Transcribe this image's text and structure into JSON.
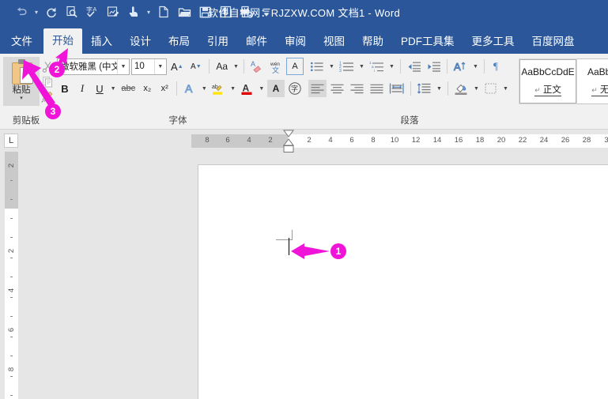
{
  "titlebar": {
    "title": "软件自学网：RJZXW.COM 文档1  -  Word",
    "qat": [
      {
        "name": "undo-icon",
        "glyph": "↶"
      },
      {
        "name": "redo-icon",
        "glyph": "↺"
      },
      {
        "name": "print-preview-icon",
        "glyph": "🗎"
      },
      {
        "name": "spelling-check-icon",
        "glyph": "字"
      },
      {
        "name": "edit-chart-icon",
        "glyph": "✎"
      },
      {
        "name": "touch-mode-icon",
        "glyph": "☝"
      },
      {
        "name": "new-document-icon",
        "glyph": "🗋"
      },
      {
        "name": "open-folder-icon",
        "glyph": "🗀"
      },
      {
        "name": "save-icon",
        "glyph": "🖫"
      },
      {
        "name": "attachment-icon",
        "glyph": "🖇"
      },
      {
        "name": "print-icon",
        "glyph": "🖶"
      },
      {
        "name": "customize-qat-icon",
        "glyph": "▾"
      }
    ]
  },
  "tabs": [
    {
      "label": "文件",
      "active": false
    },
    {
      "label": "开始",
      "active": true
    },
    {
      "label": "插入",
      "active": false
    },
    {
      "label": "设计",
      "active": false
    },
    {
      "label": "布局",
      "active": false
    },
    {
      "label": "引用",
      "active": false
    },
    {
      "label": "邮件",
      "active": false
    },
    {
      "label": "审阅",
      "active": false
    },
    {
      "label": "视图",
      "active": false
    },
    {
      "label": "帮助",
      "active": false
    },
    {
      "label": "PDF工具集",
      "active": false
    },
    {
      "label": "更多工具",
      "active": false
    },
    {
      "label": "百度网盘",
      "active": false
    }
  ],
  "ribbon": {
    "clipboard": {
      "group_label": "剪贴板",
      "paste_label": "粘贴",
      "paste_caret": "▾",
      "cut_icon": "✂",
      "copy_icon": "⧉",
      "format_painter_icon": "🖌"
    },
    "font": {
      "group_label": "字体",
      "font_name": "微软雅黑 (中文",
      "font_size": "10",
      "grow_font": "A",
      "shrink_font": "A",
      "change_case": "Aa",
      "clear_format": "✐",
      "phonetic": "wén",
      "char_border": "A",
      "bold": "B",
      "italic": "I",
      "underline": "U",
      "strikethrough": "abc",
      "subscript": "x₂",
      "superscript": "x²",
      "text_effects": "A",
      "highlight": "ab",
      "font_color": "A",
      "char_shading": "A",
      "enclose_chars": "字"
    },
    "paragraph": {
      "group_label": "段落",
      "bullets": "▪≡",
      "numbering": "1≡",
      "multilevel": "⁌≡",
      "decrease_indent": "◄≡",
      "increase_indent": "►≡",
      "sort": "A↓",
      "show_marks": "¶",
      "align_left": "≡",
      "align_center": "≡",
      "align_right": "≡",
      "justify": "≡",
      "distribute": "≡",
      "line_spacing": "↕≡",
      "shading": "◪",
      "borders": "⊞"
    },
    "styles": {
      "items": [
        {
          "preview": "AaBbCcDdE",
          "pilcrow": "↵",
          "name": "正文",
          "active": true
        },
        {
          "preview": "AaBbCc",
          "pilcrow": "↵",
          "name": "无间",
          "active": false
        }
      ]
    }
  },
  "rulers": {
    "tab_stop_marker": "L",
    "horizontal_margin_ticks": [
      "8",
      "6",
      "4",
      "2"
    ],
    "horizontal_body_ticks": [
      "2",
      "4",
      "6",
      "8",
      "10",
      "12",
      "14",
      "16",
      "18",
      "20",
      "22",
      "24",
      "26",
      "28",
      "3"
    ],
    "vertical_margin_ticks": [
      "2"
    ],
    "vertical_body_ticks": [
      "2",
      "4",
      "6",
      "8"
    ]
  },
  "document": {
    "caret_visible": true,
    "margin_mark_visible": true,
    "content": ""
  },
  "annotations": {
    "accent_color": "#f013d8",
    "markers": [
      {
        "id": "1",
        "label": "1",
        "target": "document-caret"
      },
      {
        "id": "2",
        "label": "2",
        "target": "home-tab"
      },
      {
        "id": "3",
        "label": "3",
        "target": "paste-button"
      }
    ]
  }
}
